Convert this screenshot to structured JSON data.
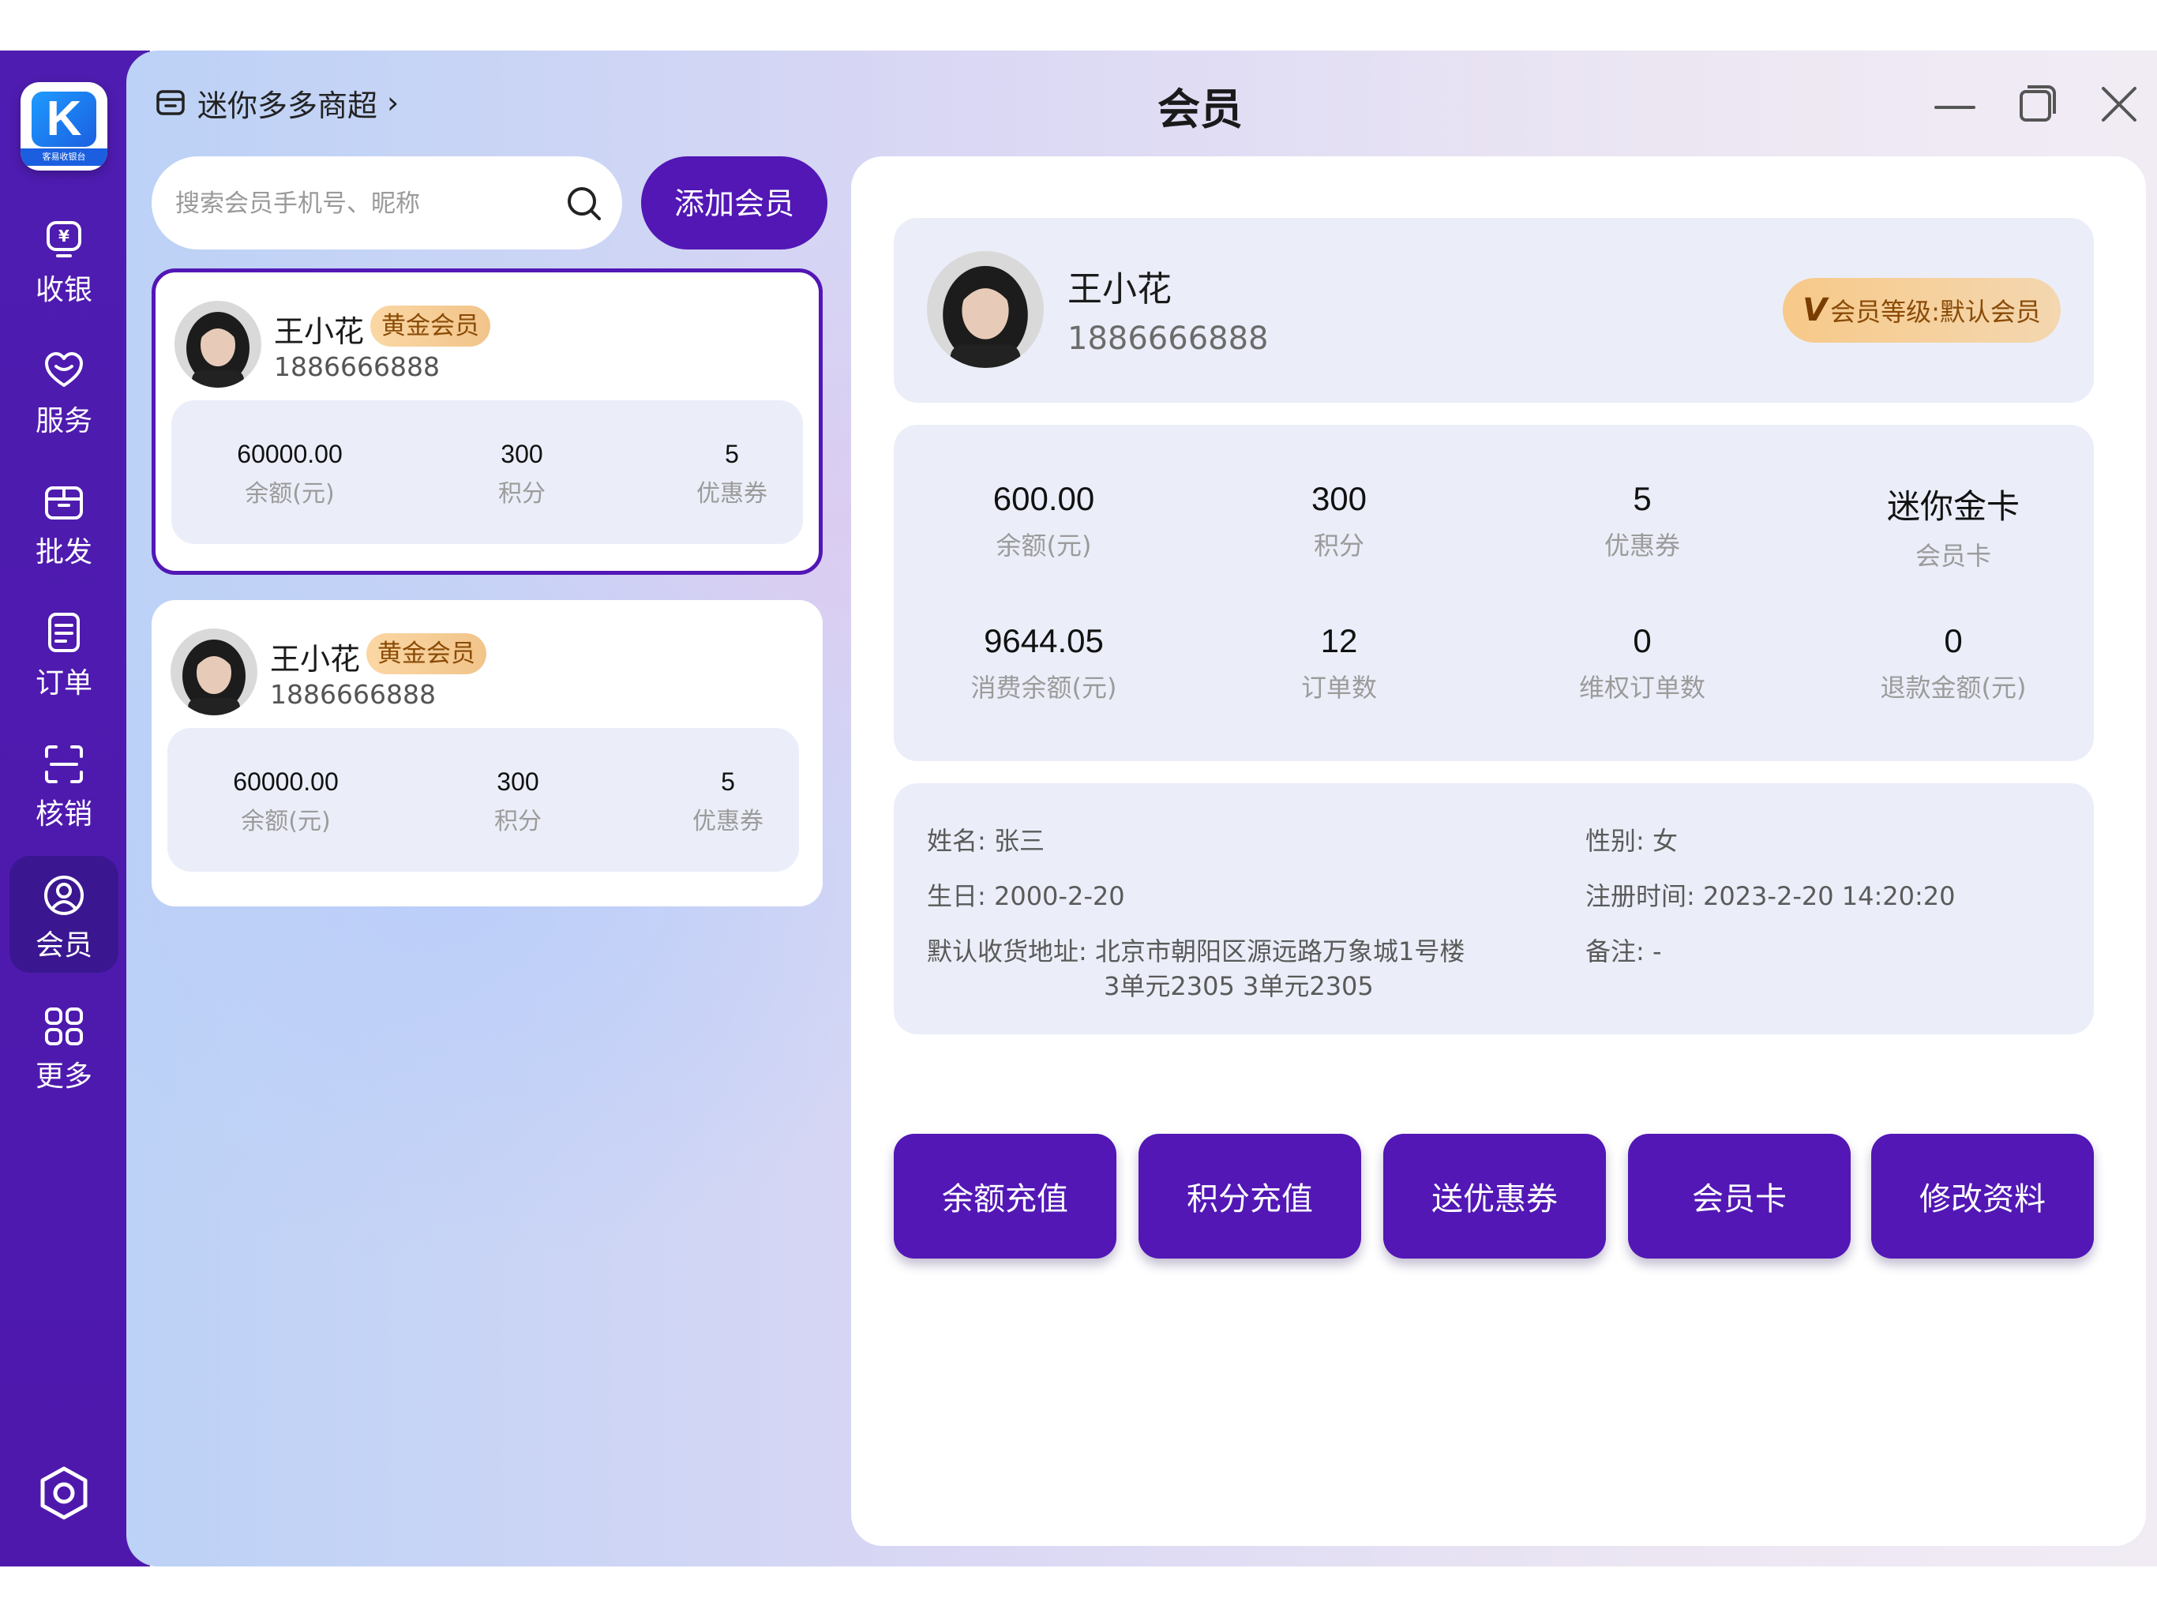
{
  "app": {
    "logo_text": "客易收银台",
    "store_name": "迷你多多商超",
    "page_title": "会员"
  },
  "sidebar": {
    "items": [
      {
        "label": "收银",
        "icon": "cashier-icon"
      },
      {
        "label": "服务",
        "icon": "heart-icon"
      },
      {
        "label": "批发",
        "icon": "box-icon"
      },
      {
        "label": "订单",
        "icon": "document-icon"
      },
      {
        "label": "核销",
        "icon": "scan-icon"
      },
      {
        "label": "会员",
        "icon": "user-icon",
        "active": true
      },
      {
        "label": "更多",
        "icon": "grid-icon"
      }
    ],
    "settings_icon": "settings-icon"
  },
  "search": {
    "placeholder": "搜索会员手机号、昵称",
    "value": ""
  },
  "add_member_label": "添加会员",
  "member_list": [
    {
      "name": "王小花",
      "badge": "黄金会员",
      "phone": "1886666888",
      "selected": true,
      "stats": [
        {
          "value": "60000.00",
          "label": "余额(元)"
        },
        {
          "value": "300",
          "label": "积分"
        },
        {
          "value": "5",
          "label": "优惠券"
        }
      ]
    },
    {
      "name": "王小花",
      "badge": "黄金会员",
      "phone": "1886666888",
      "selected": false,
      "stats": [
        {
          "value": "60000.00",
          "label": "余额(元)"
        },
        {
          "value": "300",
          "label": "积分"
        },
        {
          "value": "5",
          "label": "优惠券"
        }
      ]
    }
  ],
  "detail": {
    "name": "王小花",
    "phone": "1886666888",
    "level_badge": "会员等级:默认会员",
    "stats": [
      {
        "value": "600.00",
        "label": "余额(元)"
      },
      {
        "value": "300",
        "label": "积分"
      },
      {
        "value": "5",
        "label": "优惠券"
      },
      {
        "value": "迷你金卡",
        "label": "会员卡"
      },
      {
        "value": "9644.05",
        "label": "消费余额(元)"
      },
      {
        "value": "12",
        "label": "订单数"
      },
      {
        "value": "0",
        "label": "维权订单数"
      },
      {
        "value": "0",
        "label": "退款金额(元)"
      }
    ],
    "info": {
      "name_label": "姓名:",
      "name_value": "张三",
      "gender_label": "性别:",
      "gender_value": "女",
      "birthday_label": "生日:",
      "birthday_value": "2000-2-20",
      "register_label": "注册时间:",
      "register_value": "2023-2-20 14:20:20",
      "address_label": "默认收货地址:",
      "address_line1": "北京市朝阳区源远路万象城1号楼",
      "address_line2": "3单元2305 3单元2305",
      "remark_label": "备注:",
      "remark_value": "-"
    },
    "actions": [
      "余额充值",
      "积分充值",
      "送优惠券",
      "会员卡",
      "修改资料"
    ]
  },
  "colors": {
    "brand": "#5217B5",
    "sidebar": "#4E1CB0",
    "gold_badge": "#F1C48A"
  }
}
